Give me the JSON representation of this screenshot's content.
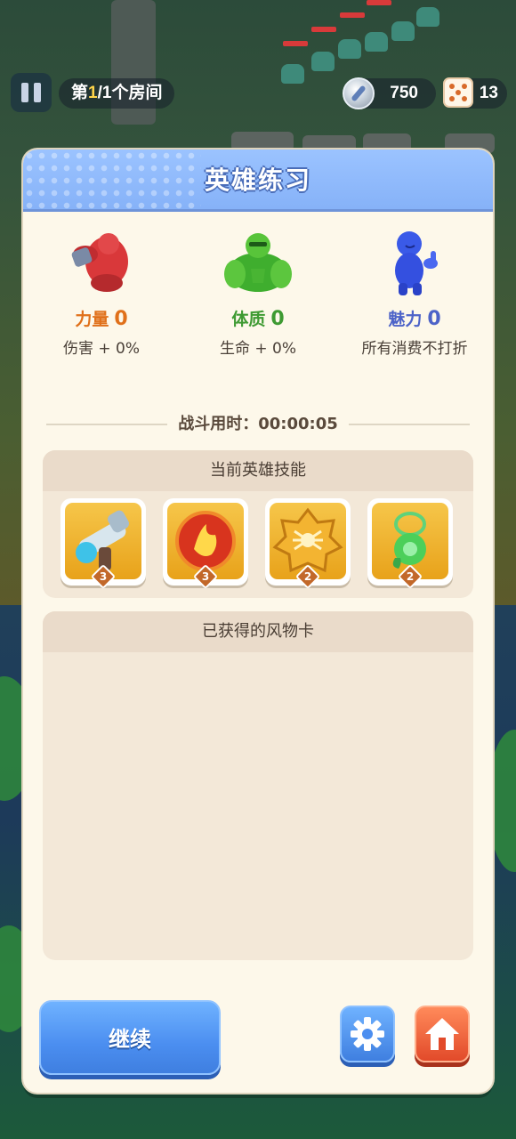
{
  "hud": {
    "room_prefix": "第",
    "room_current": "1",
    "room_suffix": "/1个房间",
    "coins": "750",
    "dice": "13"
  },
  "panel": {
    "title": "英雄练习",
    "stats": [
      {
        "name": "力量",
        "value": "0",
        "desc": "伤害 + 0%",
        "color": "#e0701a",
        "icon": "red-muscle-hero-icon"
      },
      {
        "name": "体质",
        "value": "0",
        "desc": "生命 + 0%",
        "color": "#3e9a32",
        "icon": "green-muscle-hero-icon"
      },
      {
        "name": "魅力",
        "value": "0",
        "desc": "所有消费不打折",
        "color": "#4d63c8",
        "icon": "blue-thumbs-up-hero-icon"
      }
    ],
    "battle_time_label": "战斗用时：",
    "battle_time": "00:00:05",
    "skills_title": "当前英雄技能",
    "skills": [
      {
        "icon": "blaster-gun-icon",
        "level": "3"
      },
      {
        "icon": "fire-orb-icon",
        "level": "3"
      },
      {
        "icon": "spider-badge-icon",
        "level": "2"
      },
      {
        "icon": "green-pendant-icon",
        "level": "2"
      }
    ],
    "relics_title": "已获得的风物卡",
    "continue_label": "继续",
    "settings_icon": "gear-icon",
    "home_icon": "home-icon"
  }
}
